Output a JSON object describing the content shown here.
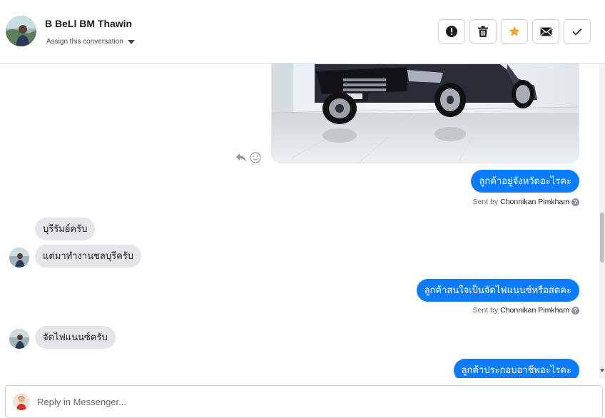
{
  "header": {
    "contact_name": "B BeLl BM Thawin",
    "assign_label": "Assign this conversation",
    "actions": [
      {
        "icon": "alert-icon",
        "color": "#1c1e21"
      },
      {
        "icon": "trash-icon",
        "color": "#1c1e21"
      },
      {
        "icon": "star-icon",
        "color": "#f5a623"
      },
      {
        "icon": "mail-icon",
        "color": "#1c1e21"
      },
      {
        "icon": "check-icon",
        "color": "#1c1e21"
      }
    ]
  },
  "thread": {
    "messages": [
      {
        "direction": "outgoing",
        "type": "image",
        "icon": "car-photo"
      },
      {
        "direction": "outgoing",
        "text": "ลูกค้าอยู่จังหวัดอะไรคะ",
        "sent_by_prefix": "Sent by",
        "sent_by_name": "Chonnikan Pimkham"
      },
      {
        "direction": "incoming",
        "text": "บุรีรัมย์ครับ"
      },
      {
        "direction": "incoming",
        "text": "แต่มาทำงานชลบุรีครับ"
      },
      {
        "direction": "outgoing",
        "text": "ลูกค้าสนใจเป็นจัดไฟแนนซ์หรือสดคะ",
        "sent_by_prefix": "Sent by",
        "sent_by_name": "Chonnikan Pimkham"
      },
      {
        "direction": "incoming",
        "text": "จัดไฟแนนซ์ครับ"
      },
      {
        "direction": "outgoing",
        "text": "ลูกค้าประกอบอาชีพอะไรคะ"
      }
    ]
  },
  "composer": {
    "placeholder": "Reply in Messenger..."
  },
  "colors": {
    "outgoing_bubble": "#0a7cff",
    "incoming_bubble": "#e4e6eb",
    "star": "#f5a623"
  }
}
